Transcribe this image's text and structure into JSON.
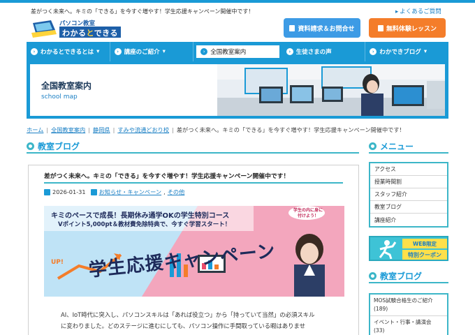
{
  "header": {
    "tagline": "差がつく未来へ。キミの「できる」を今すぐ増やす！学生応援キャンペーン開催中です！",
    "faq_link": "よくあるご質問",
    "logo_sub": "パソコン教室",
    "logo_main_a": "わかる",
    "logo_main_b": "と",
    "logo_main_c": "できる",
    "inquiry_button": "資料請求＆お問合せ",
    "trial_button": "無料体験レッスン"
  },
  "nav": {
    "items": [
      {
        "label": "わかるとできるとは"
      },
      {
        "label": "講座のご紹介"
      },
      {
        "label": "全国教室案内"
      },
      {
        "label": "生徒さまの声"
      },
      {
        "label": "わかできブログ"
      }
    ]
  },
  "hero": {
    "title": "全国教室案内",
    "subtitle": "school map"
  },
  "breadcrumb": {
    "items": [
      "ホーム",
      "全国教室案内",
      "静岡県",
      "すみや流通どおり校"
    ],
    "current": "差がつく未来へ。キミの「できる」を今すぐ増やす！学生応援キャンペーン開催中です！"
  },
  "main": {
    "section_title": "教室ブログ",
    "article": {
      "title": "差がつく未来へ。キミの「できる」を今すぐ増やす！学生応援キャンペーン開催中です！",
      "date": "2026-01-31",
      "category_1": "お知らせ・キャンペーン",
      "separator": ",",
      "category_2": "その他",
      "banner": {
        "headline": "キミのペースで成長！長期休み通学OKの学生特別コース",
        "subline": "Vポイント5,000pt＆教材費免除特典で、今すぐ学習スタート！",
        "bubble": "学生の内に身に付けよう！",
        "big_text": "学生応援キャンペーン",
        "up_text": "UP!"
      },
      "body_line_1": "AI、IoT時代に突入し、パソコンスキルは「あれば役立つ」から「持っていて当然」の必須スキル",
      "body_line_2": "に変わりました。どのステージに進むにしても、パソコン操作に手間取っている暇はありませ"
    }
  },
  "sidebar": {
    "menu_title": "メニュー",
    "menu_items": [
      "アクセス",
      "授業時間割",
      "スタッフ紹介",
      "教室ブログ",
      "講座紹介"
    ],
    "coupon_tag": "WEB限定",
    "coupon_label": "特別クーポン",
    "blog_title": "教室ブログ",
    "categories": [
      "MOS試験合格生のご紹介 (189)",
      "イベント・行事・講演会 (33)"
    ]
  },
  "colors": {
    "primary": "#1a9ad6",
    "accent_teal": "#3cb6c8",
    "orange": "#f47d2a",
    "banner_pink": "#f3a6bd",
    "banner_blue": "#bfe3f6"
  }
}
